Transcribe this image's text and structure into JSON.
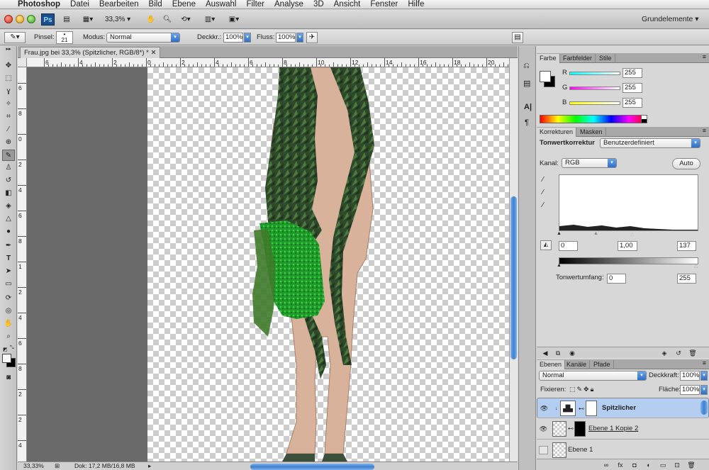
{
  "menubar": {
    "items": [
      "Photoshop",
      "Datei",
      "Bearbeiten",
      "Bild",
      "Ebene",
      "Auswahl",
      "Filter",
      "Analyse",
      "3D",
      "Ansicht",
      "Fenster",
      "Hilfe"
    ]
  },
  "appbar": {
    "logo": "Ps",
    "zoom": "33,3%",
    "workspace": "Grundelemente"
  },
  "options": {
    "brush_label": "Pinsel:",
    "brush_size": "21",
    "mode_label": "Modus:",
    "mode_value": "Normal",
    "opacity_label": "Deckkr.:",
    "opacity_value": "100%",
    "flow_label": "Fluss:",
    "flow_value": "100%"
  },
  "document": {
    "tab_title": "Frau.jpg bei 33,3% (Spitzlicher, RGB/8*) *",
    "hruler_labels": [
      "6",
      "4",
      "2",
      "0",
      "2",
      "4",
      "6",
      "8",
      "10",
      "12",
      "14",
      "16",
      "18",
      "20"
    ],
    "vruler_labels": [
      "6",
      "8",
      "0",
      "2",
      "4",
      "6",
      "8",
      "1",
      "2",
      "4",
      "6",
      "8",
      "2",
      "2",
      "4"
    ]
  },
  "status": {
    "zoom": "33,33%",
    "doc": "Dok: 17,2 MB/16,8 MB"
  },
  "color_panel": {
    "tabs": [
      "Farbe",
      "Farbfelder",
      "Stile"
    ],
    "channels": [
      {
        "label": "R",
        "value": "255"
      },
      {
        "label": "G",
        "value": "255"
      },
      {
        "label": "B",
        "value": "255"
      }
    ]
  },
  "adjustments_panel": {
    "tabs": [
      "Korrekturen",
      "Masken"
    ],
    "title": "Tonwertkorrektur",
    "preset": "Benutzerdefiniert",
    "channel_label": "Kanal:",
    "channel_value": "RGB",
    "auto_label": "Auto",
    "input_black": "0",
    "input_gamma": "1,00",
    "input_white": "137",
    "output_label": "Tonwertumfang:",
    "output_black": "0",
    "output_white": "255"
  },
  "layers_panel": {
    "tabs": [
      "Ebenen",
      "Kanäle",
      "Pfade"
    ],
    "blend_mode": "Normal",
    "opacity_label": "Deckkraft:",
    "opacity_value": "100%",
    "lock_label": "Fixieren:",
    "fill_label": "Fläche:",
    "fill_value": "100%",
    "layers": [
      "Spitzlicher",
      "Ebene 1 Kopie 2",
      "Ebene 1"
    ]
  },
  "colors": {
    "selection_blue": "#b3cef0",
    "scroll_blue": "#3d7fd0"
  }
}
